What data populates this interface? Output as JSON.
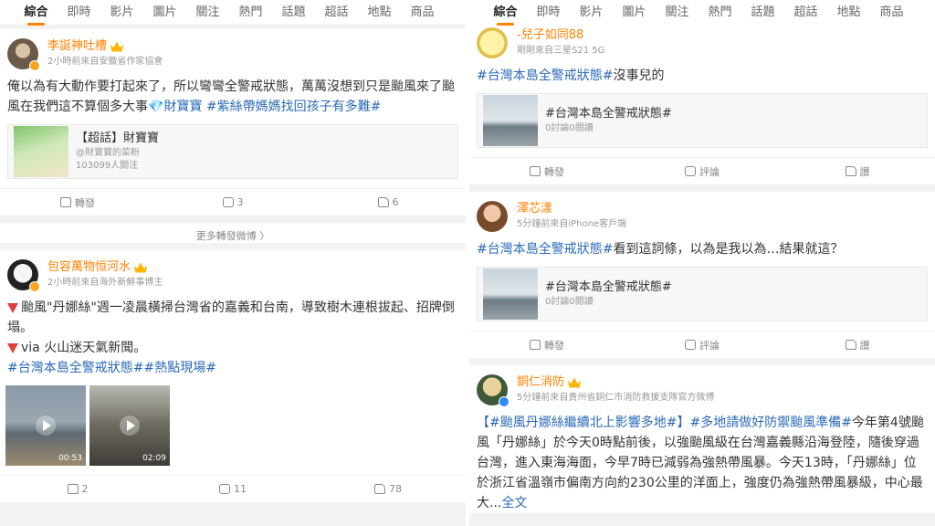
{
  "tabs": [
    "綜合",
    "即時",
    "影片",
    "圖片",
    "關注",
    "熱門",
    "話題",
    "超話",
    "地點",
    "商品"
  ],
  "left": {
    "post1": {
      "name": "李誕神吐槽",
      "sub": "2小時前來自安徽省作家協會",
      "text_a": "俺以為有大動作要打起來了，所以彎彎全警戒狀態，萬萬沒想到只是颱風來了颱風在我們這不算個多大事",
      "gem": "💎",
      "tag1": "財寶寶",
      "tag2": "#紫絲帶媽媽找回孩子有多難#",
      "card_title": "【超話】財寶寶",
      "card_sub1": "@財寶寶的菜粉",
      "card_sub2": "103099人關注",
      "repost": "轉發",
      "comments": "3",
      "likes": "6"
    },
    "more": "更多轉發微博 〉",
    "post2": {
      "name": "包容萬物恒河水",
      "sub": "2小時前來自海外新鮮事博主",
      "line1": "颱風\"丹娜絲\"週一凌晨橫掃台灣省的嘉義和台南，導致樹木連根拔起、招牌倒塌。",
      "line2": "via 火山迷天氣新聞。",
      "tag1": "#台灣本島全警戒狀態#",
      "tag2": "#熱點現場#",
      "v1_dur": "00:53",
      "v2_dur": "02:09",
      "reposts": "2",
      "comments": "11",
      "likes": "78"
    }
  },
  "right": {
    "post1": {
      "name": "-兒子如同88",
      "sub": "剛剛來自三星S21 5G",
      "tag": "#台灣本島全警戒狀態#",
      "text": "沒事兒的",
      "card_title": "#台灣本島全警戒狀態#",
      "card_sub": "0討論0閱讀",
      "repost": "轉發",
      "comment": "評論",
      "like": "讚"
    },
    "post2": {
      "name": "澤芯漾",
      "sub": "5分鐘前來自iPhone客戶端",
      "tag": "#台灣本島全警戒狀態#",
      "text": "看到這詞條，以為是我以為…結果就這？",
      "card_title": "#台灣本島全警戒狀態#",
      "card_sub": "0討論0閱讀",
      "repost": "轉發",
      "comment": "評論",
      "like": "讚"
    },
    "post3": {
      "name": "銅仁消防",
      "sub": "5分鐘前來自貴州省銅仁市消防救援支隊官方微博",
      "lead": "【",
      "tag1": "#颱風丹娜絲繼續北上影響多地#",
      "mid": "】",
      "tag2": "#多地請做好防禦颱風準備#",
      "body": "今年第4號颱風「丹娜絲」於今天0時點前後，以強颱風級在台灣嘉義縣沿海登陸，隨後穿過台灣，進入東海海面，今早7時已減弱為強熱帶風暴。今天13時，「丹娜絲」位於浙江省溫嶺市偏南方向約230公里的洋面上，強度仍為強熱帶風暴級，中心最大...",
      "full": "全文"
    }
  }
}
